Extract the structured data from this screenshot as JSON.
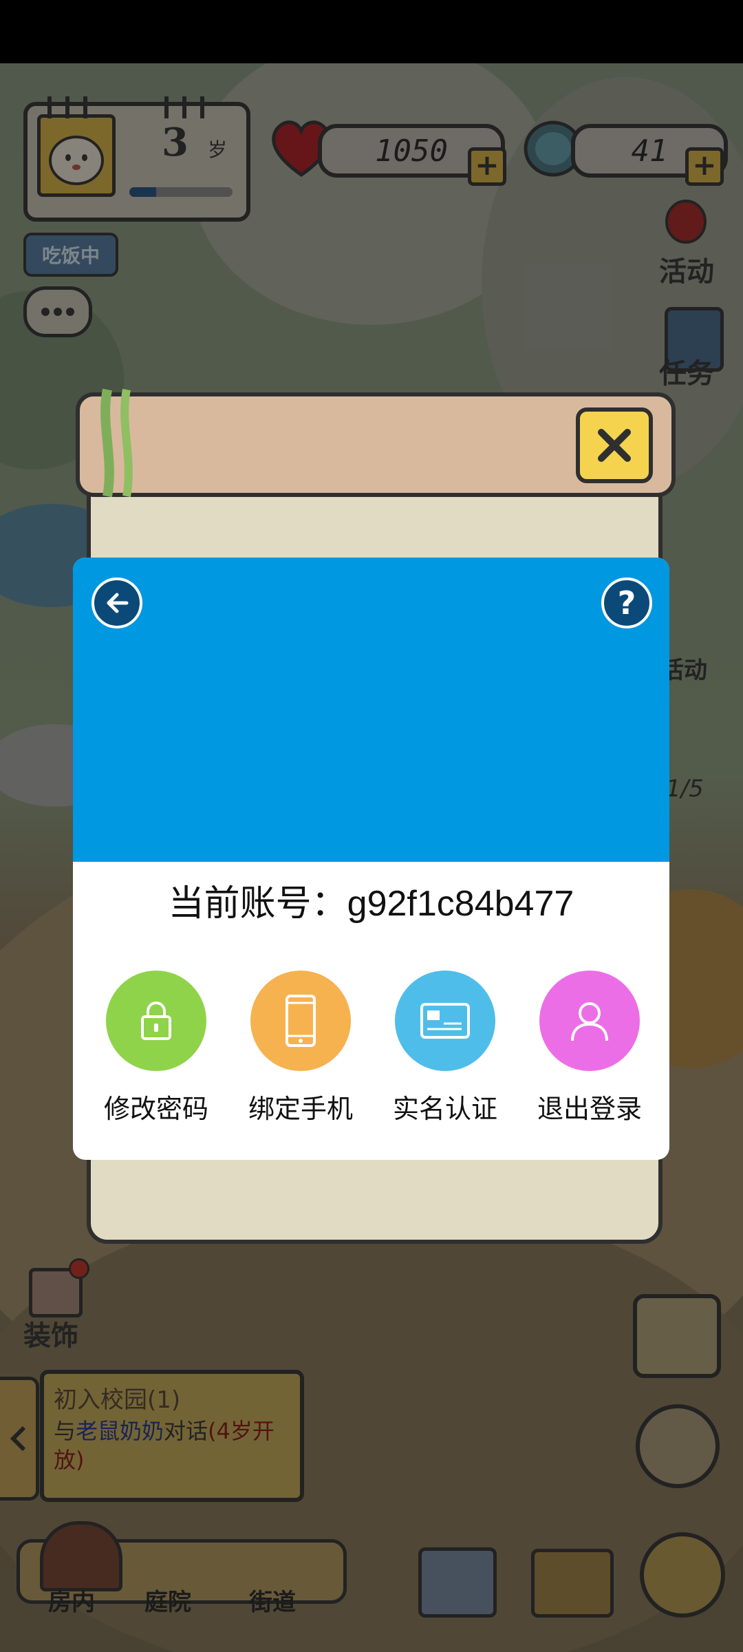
{
  "hud": {
    "age_number": "3",
    "age_unit": "岁",
    "status_badge": "吃饭中",
    "hearts": "1050",
    "gems": "41",
    "plus_label": "+"
  },
  "side_menu": {
    "activity": "活动",
    "task": "任务",
    "activity2_partial": "活动",
    "counter_partial": "1/5",
    "decoration": "装饰"
  },
  "quest": {
    "title": "初入校园(1)",
    "desc_prefix": "与",
    "desc_npc": "老鼠奶奶",
    "desc_action": "对话",
    "desc_note": "(4岁开放)"
  },
  "bottom_nav": {
    "room": "房内",
    "yard": "庭院",
    "street": "街道"
  },
  "dialog": {
    "account_label": "当前账号：",
    "account_id": "g92f1c84b477",
    "actions": [
      {
        "label": "修改密码",
        "icon": "lock-icon",
        "color": "#8fd34a"
      },
      {
        "label": "绑定手机",
        "icon": "phone-icon",
        "color": "#f6b24f"
      },
      {
        "label": "实名认证",
        "icon": "id-card-icon",
        "color": "#4fbde9"
      },
      {
        "label": "退出登录",
        "icon": "user-icon",
        "color": "#ec6ee6"
      }
    ]
  },
  "colors": {
    "dialog_header": "#0098e0",
    "heart": "#c0282a",
    "close_button": "#f5d34f"
  }
}
